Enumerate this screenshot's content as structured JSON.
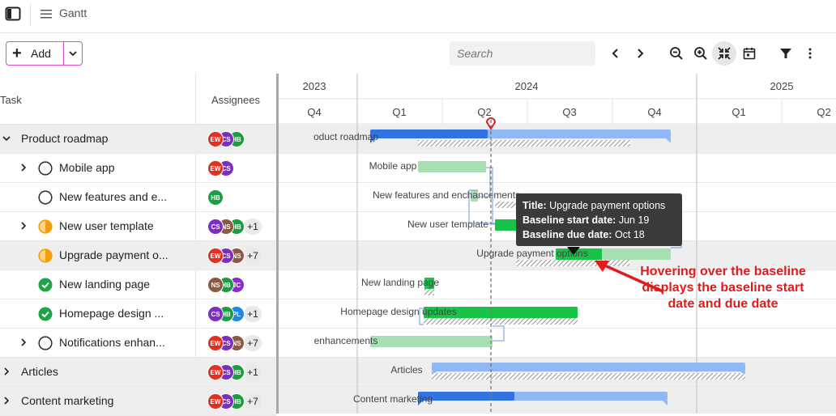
{
  "app": {
    "title": "Gantt"
  },
  "toolbar": {
    "add_label": "Add",
    "search_placeholder": "Search"
  },
  "grid": {
    "columns": {
      "task": "Task",
      "assignees": "Assignees"
    },
    "rows": [
      {
        "name": "Product roadmap",
        "type": "group",
        "expander": "chevron-down",
        "status": null,
        "avatars": [
          "EW",
          "CS",
          "HB"
        ],
        "more": ""
      },
      {
        "name": "Mobile app",
        "type": "task",
        "expander": "chevron-right",
        "status": "empty",
        "avatars": [
          "EW",
          "CS"
        ],
        "more": ""
      },
      {
        "name": "New features and e...",
        "type": "task",
        "expander": null,
        "status": "empty",
        "avatars": [
          "HB"
        ],
        "more": ""
      },
      {
        "name": "New user template",
        "type": "task",
        "expander": "chevron-right",
        "status": "half",
        "avatars": [
          "CS",
          "NS",
          "HB"
        ],
        "more": "+1"
      },
      {
        "name": "Upgrade payment o...",
        "type": "task",
        "expander": null,
        "status": "half",
        "avatars": [
          "EW",
          "CS",
          "NS"
        ],
        "more": "+7"
      },
      {
        "name": "New landing page",
        "type": "task",
        "expander": null,
        "status": "done",
        "avatars": [
          "NS",
          "HB",
          "JC"
        ],
        "more": ""
      },
      {
        "name": "Homepage design ...",
        "type": "task",
        "expander": null,
        "status": "done",
        "avatars": [
          "CS",
          "HB",
          "PL"
        ],
        "more": "+1"
      },
      {
        "name": "Notifications enhan...",
        "type": "task",
        "expander": "chevron-right",
        "status": "empty",
        "avatars": [
          "EW",
          "CS",
          "NS"
        ],
        "more": "+7"
      },
      {
        "name": "Articles",
        "type": "group",
        "expander": "chevron-right",
        "status": null,
        "avatars": [
          "EW",
          "CS",
          "HB"
        ],
        "more": "+1"
      },
      {
        "name": "Content marketing",
        "type": "group",
        "expander": "chevron-right",
        "status": null,
        "avatars": [
          "EW",
          "CS",
          "HB"
        ],
        "more": "+7"
      }
    ]
  },
  "timeline": {
    "years": [
      "2023",
      "2024",
      "2025"
    ],
    "quarters": [
      "Q4",
      "Q1",
      "Q2",
      "Q3",
      "Q4",
      "Q1",
      "Q2"
    ],
    "bar_labels": [
      "oduct roadmap",
      "Mobile app",
      "New features and enchancements",
      "New user template",
      "Upgrade payment options",
      "New landing page",
      "Homepage design updates",
      "enhancements",
      "Articles",
      "Content marketing"
    ]
  },
  "tooltip": {
    "title_label": "Title:",
    "title_value": "Upgrade payment options",
    "start_label": "Baseline start date:",
    "start_value": "Jun 19",
    "due_label": "Baseline due date:",
    "due_value": "Oct 18"
  },
  "annotation": "Hovering over the baseline displays the baseline start date and due date",
  "colors": {
    "EW": "#e0301e",
    "CS": "#7b2fbf",
    "HB": "#1a9e3f",
    "NS": "#8a5a44",
    "JC": "#8e2dc9",
    "PL": "#1e88e5",
    "bar_blue": "#2f74e0",
    "bar_light_blue": "#8fb8f5",
    "bar_green": "#17c447",
    "bar_light_green": "#a6dfb2",
    "today": "#e02020"
  }
}
